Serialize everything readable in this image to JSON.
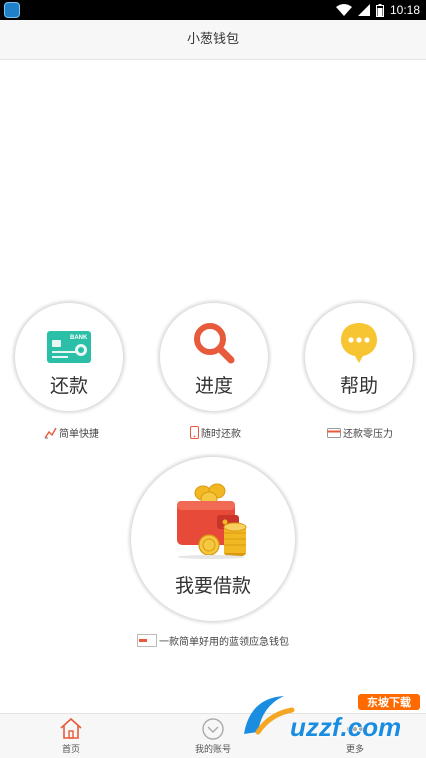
{
  "status_bar": {
    "time": "10:18"
  },
  "header": {
    "title": "小葱钱包"
  },
  "actions": [
    {
      "label": "还款",
      "icon": "bank-card-icon",
      "hint": "简单快捷",
      "hint_icon": "trend-line-icon"
    },
    {
      "label": "进度",
      "icon": "magnifier-icon",
      "hint": "随时还款",
      "hint_icon": "phone-icon"
    },
    {
      "label": "帮助",
      "icon": "chat-bubble-icon",
      "hint": "还款零压力",
      "hint_icon": "card-icon"
    }
  ],
  "main_action": {
    "label": "我要借款",
    "icon": "wallet-coins-icon"
  },
  "slogan": {
    "text": "一款简单好用的蓝领应急钱包"
  },
  "tabs": [
    {
      "label": "首页",
      "icon": "home-icon",
      "active": true
    },
    {
      "label": "我的账号",
      "icon": "account-icon",
      "active": false
    },
    {
      "label": "更多",
      "icon": "more-icon",
      "active": false
    }
  ],
  "watermark": {
    "brand": "uzzf.com",
    "tag": "东坡下载"
  },
  "colors": {
    "accent_red": "#e85a3c",
    "bank_green": "#2bbfa8",
    "bubble_yellow": "#f7c531",
    "coin_gold": "#f2b824"
  }
}
